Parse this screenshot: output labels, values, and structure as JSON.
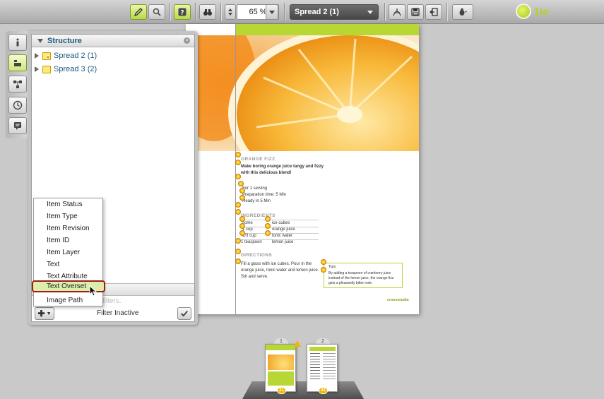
{
  "toolbar": {
    "zoom_value": "65 %",
    "spread_selected": "Spread 2 (1)",
    "logo_text": "1io"
  },
  "sidebar_tabs": [
    "info-icon",
    "structure-icon",
    "flow-icon",
    "history-icon",
    "comment-icon"
  ],
  "structure_panel": {
    "title": "Structure",
    "tree": [
      {
        "label": "Spread 2 (1)",
        "has_warning": true
      },
      {
        "label": "Spread 3 (2)",
        "has_warning": false
      }
    ],
    "filter_placeholder": "filters.",
    "filter_status": "Filter Inactive"
  },
  "filter_menu": {
    "items": [
      "Item Status",
      "Item Type",
      "Item Revision",
      "Item ID",
      "Item Layer",
      "Text",
      "Text Attribute",
      "Text Overset",
      "Image Path"
    ],
    "highlighted": "Text Overset"
  },
  "document": {
    "recipe_title": "ORANGE FIZZ",
    "subtitle_line1": "Make boring orange juice tangy and fizzy",
    "subtitle_line2": "with this delicious blend!",
    "info": [
      "For 1 serving",
      "Preparation time: 5 Min",
      "Ready in 5 Min"
    ],
    "ingredients_title": "INGREDIENTS",
    "ingredients": [
      {
        "qty": "some",
        "item": "ice cubes"
      },
      {
        "qty": "1 cup",
        "item": "orange juice"
      },
      {
        "qty": "1/3 cup",
        "item": "tonic water"
      },
      {
        "qty": "1 teaspoon",
        "item": "lemon juice"
      }
    ],
    "directions_title": "DIRECTIONS",
    "directions": [
      "Fill a glass with ice cubes. Pour in the",
      "orange juice, tonic water and lemon juice.",
      "Stir and serve."
    ],
    "tip_title": "Tips",
    "tip": [
      "By adding a teaspoon of cranberry juice",
      "instead of the lemon juice, the orange fizz",
      "gets a pleasantly bitter note"
    ],
    "footer_brand": "crossmedia"
  },
  "spreads": [
    {
      "number": "1",
      "count": "21"
    },
    {
      "number": "2",
      "count": "33"
    }
  ]
}
